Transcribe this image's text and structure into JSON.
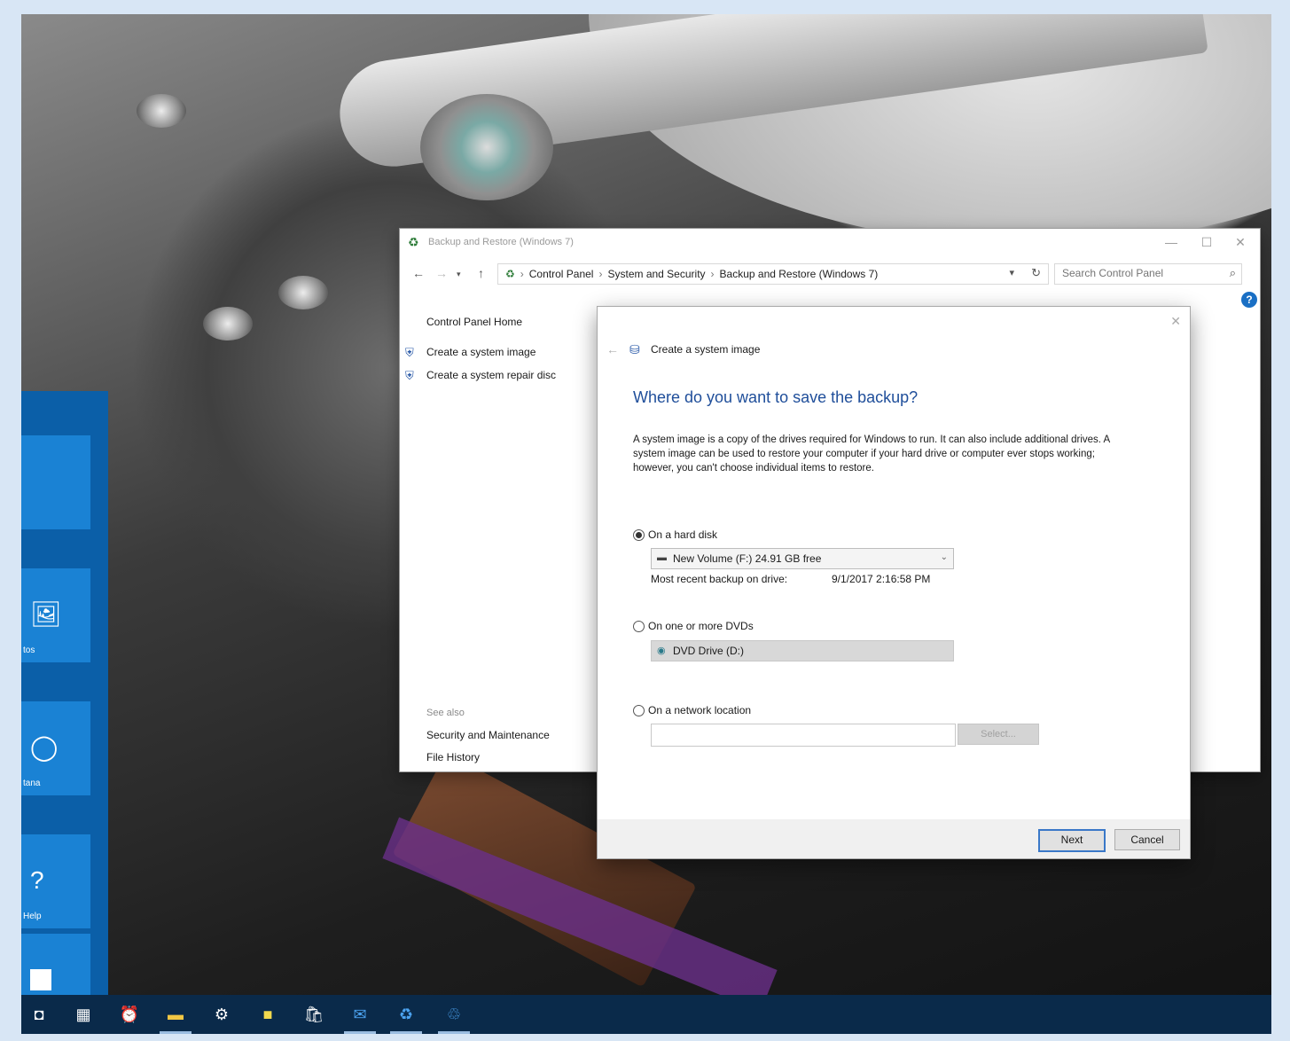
{
  "start_tiles": [
    {
      "icon": "🖼",
      "label": "tos"
    },
    {
      "icon": "◯",
      "label": "tana"
    },
    {
      "icon": "?",
      "label": "Help"
    }
  ],
  "taskbar": [
    "camera-icon",
    "calculator-icon",
    "alarm-icon",
    "file-explorer-icon",
    "settings-icon",
    "sticky-notes-icon",
    "store-icon",
    "mail-icon",
    "control-panel-icon",
    "backup-icon"
  ],
  "control_panel": {
    "title": "Backup and Restore (Windows 7)",
    "breadcrumb": [
      "Control Panel",
      "System and Security",
      "Backup and Restore (Windows 7)"
    ],
    "search_placeholder": "Search Control Panel",
    "home_link": "Control Panel Home",
    "tasks": [
      "Create a system image",
      "Create a system repair disc"
    ],
    "see_also_label": "See also",
    "see_also": [
      "Security and Maintenance",
      "File History"
    ]
  },
  "dialog": {
    "header": "Create a system image",
    "question": "Where do you want to save the backup?",
    "description": "A system image is a copy of the drives required for Windows to run. It can also include additional drives. A system image can be used to restore your computer if your hard drive or computer ever stops working; however, you can't choose individual items to restore.",
    "options": {
      "hard_disk": {
        "label": "On a hard disk",
        "selected": true,
        "drive": "New Volume (F:)  24.91 GB free"
      },
      "recent_label": "Most recent backup on drive:",
      "recent_value": "9/1/2017 2:16:58 PM",
      "dvd": {
        "label": "On one or more DVDs",
        "selected": false,
        "drive": "DVD Drive (D:)"
      },
      "network": {
        "label": "On a network location",
        "selected": false,
        "value": "",
        "select_button": "Select..."
      }
    },
    "buttons": {
      "next": "Next",
      "cancel": "Cancel"
    }
  }
}
